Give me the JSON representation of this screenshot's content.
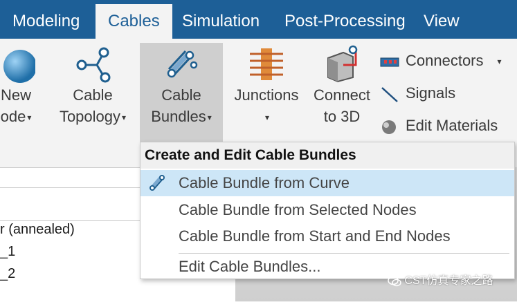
{
  "tabs": [
    "Modeling",
    "Cables",
    "Simulation",
    "Post-Processing",
    "View"
  ],
  "ribbon": {
    "new_node": {
      "line1": "New",
      "line2": "ode"
    },
    "cable_topology": {
      "line1": "Cable",
      "line2": "Topology"
    },
    "cable_bundles": {
      "line1": "Cable",
      "line2": "Bundles"
    },
    "junctions": {
      "line1": "Junctions"
    },
    "connect_3d": {
      "line1": "Connect",
      "line2": "to 3D"
    },
    "small": [
      "Connectors",
      "Signals",
      "Edit Materials"
    ]
  },
  "tree": [
    "r (annealed)",
    "_1",
    "_2"
  ],
  "menu": {
    "header": "Create and Edit Cable Bundles",
    "items": [
      "Cable Bundle from Curve",
      "Cable Bundle from Selected Nodes",
      "Cable Bundle from Start and End Nodes",
      "Edit Cable Bundles..."
    ]
  },
  "watermark": "CST仿真专家之路",
  "colors": {
    "tab_bar": "#1d5f97",
    "highlight": "#cde6f7"
  }
}
